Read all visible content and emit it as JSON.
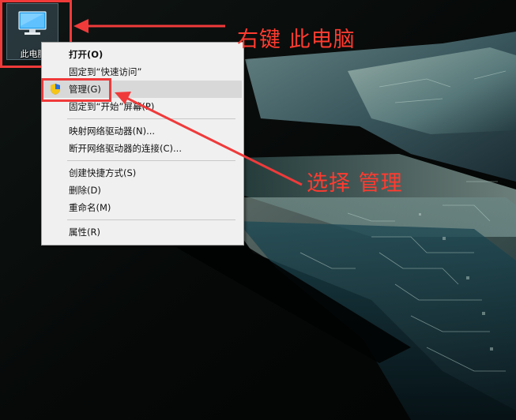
{
  "desktop": {
    "icon_label": "此电脑",
    "icon_name": "this-pc-icon"
  },
  "context_menu": {
    "groups": [
      [
        {
          "label": "打开(O)",
          "bold": true
        },
        {
          "label": "固定到“快速访问”"
        },
        {
          "label": "管理(G)",
          "icon": "shield-icon",
          "highlighted": true
        },
        {
          "label": "固定到“开始”屏幕(P)"
        }
      ],
      [
        {
          "label": "映射网络驱动器(N)..."
        },
        {
          "label": "断开网络驱动器的连接(C)..."
        }
      ],
      [
        {
          "label": "创建快捷方式(S)"
        },
        {
          "label": "删除(D)"
        },
        {
          "label": "重命名(M)"
        }
      ],
      [
        {
          "label": "属性(R)"
        }
      ]
    ]
  },
  "annotations": {
    "step1": "右键  此电脑",
    "step2": "选择  管理",
    "color": "#f03a3a"
  },
  "colors": {
    "menu_bg": "#f0f0f0",
    "menu_highlight": "#d8d8d8",
    "annotation_red": "#ff3b30",
    "shield_blue": "#2a6fd6",
    "shield_yellow": "#f5c518"
  }
}
